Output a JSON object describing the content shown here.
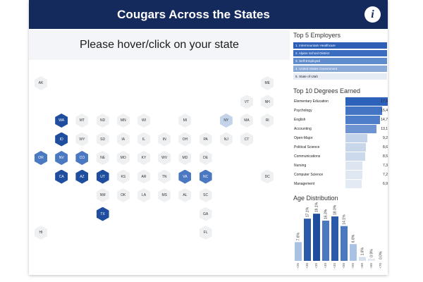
{
  "header": {
    "title": "Cougars Across the States",
    "info_icon": "info-icon",
    "info_glyph": "i"
  },
  "prompt": {
    "text": "Please hover/click on your state"
  },
  "colors": {
    "header_bg": "#142a5c",
    "dark": "#1f4e9e",
    "mid": "#4a79c1",
    "light": "#c3d3e9",
    "pale": "#e3ebf5",
    "faint": "#eef0f2"
  },
  "states": [
    {
      "abbr": "AK",
      "shade": "faint",
      "col": 0,
      "row": 0
    },
    {
      "abbr": "ME",
      "shade": "faint",
      "col": 11,
      "row": 0
    },
    {
      "abbr": "VT",
      "shade": "faint",
      "col": 10,
      "row": 1
    },
    {
      "abbr": "NH",
      "shade": "faint",
      "col": 11,
      "row": 1
    },
    {
      "abbr": "WA",
      "shade": "dark",
      "col": 1,
      "row": 2
    },
    {
      "abbr": "MT",
      "shade": "faint",
      "col": 2,
      "row": 2
    },
    {
      "abbr": "ND",
      "shade": "faint",
      "col": 3,
      "row": 2
    },
    {
      "abbr": "MN",
      "shade": "faint",
      "col": 4,
      "row": 2
    },
    {
      "abbr": "WI",
      "shade": "faint",
      "col": 5,
      "row": 2
    },
    {
      "abbr": "MI",
      "shade": "faint",
      "col": 7,
      "row": 2
    },
    {
      "abbr": "NY",
      "shade": "light",
      "col": 9,
      "row": 2
    },
    {
      "abbr": "MA",
      "shade": "faint",
      "col": 10,
      "row": 2
    },
    {
      "abbr": "RI",
      "shade": "faint",
      "col": 11,
      "row": 2
    },
    {
      "abbr": "ID",
      "shade": "dark",
      "col": 1,
      "row": 3
    },
    {
      "abbr": "WY",
      "shade": "faint",
      "col": 2,
      "row": 3
    },
    {
      "abbr": "SD",
      "shade": "faint",
      "col": 3,
      "row": 3
    },
    {
      "abbr": "IA",
      "shade": "faint",
      "col": 4,
      "row": 3
    },
    {
      "abbr": "IL",
      "shade": "faint",
      "col": 5,
      "row": 3
    },
    {
      "abbr": "IN",
      "shade": "faint",
      "col": 6,
      "row": 3
    },
    {
      "abbr": "OH",
      "shade": "faint",
      "col": 7,
      "row": 3
    },
    {
      "abbr": "PA",
      "shade": "faint",
      "col": 8,
      "row": 3
    },
    {
      "abbr": "NJ",
      "shade": "faint",
      "col": 9,
      "row": 3
    },
    {
      "abbr": "CT",
      "shade": "faint",
      "col": 10,
      "row": 3
    },
    {
      "abbr": "OR",
      "shade": "mid",
      "col": 0,
      "row": 4
    },
    {
      "abbr": "NV",
      "shade": "mid",
      "col": 1,
      "row": 4
    },
    {
      "abbr": "CO",
      "shade": "mid",
      "col": 2,
      "row": 4
    },
    {
      "abbr": "NE",
      "shade": "faint",
      "col": 3,
      "row": 4
    },
    {
      "abbr": "MO",
      "shade": "faint",
      "col": 4,
      "row": 4
    },
    {
      "abbr": "KY",
      "shade": "faint",
      "col": 5,
      "row": 4
    },
    {
      "abbr": "WV",
      "shade": "faint",
      "col": 6,
      "row": 4
    },
    {
      "abbr": "MD",
      "shade": "faint",
      "col": 7,
      "row": 4
    },
    {
      "abbr": "DE",
      "shade": "faint",
      "col": 8,
      "row": 4
    },
    {
      "abbr": "CA",
      "shade": "dark",
      "col": 1,
      "row": 5
    },
    {
      "abbr": "AZ",
      "shade": "dark",
      "col": 2,
      "row": 5
    },
    {
      "abbr": "UT",
      "shade": "dark",
      "col": 3,
      "row": 5
    },
    {
      "abbr": "KS",
      "shade": "faint",
      "col": 4,
      "row": 5
    },
    {
      "abbr": "AR",
      "shade": "faint",
      "col": 5,
      "row": 5
    },
    {
      "abbr": "TN",
      "shade": "faint",
      "col": 6,
      "row": 5
    },
    {
      "abbr": "VA",
      "shade": "mid",
      "col": 7,
      "row": 5
    },
    {
      "abbr": "NC",
      "shade": "mid",
      "col": 8,
      "row": 5
    },
    {
      "abbr": "DC",
      "shade": "faint",
      "col": 11,
      "row": 5
    },
    {
      "abbr": "NM",
      "shade": "faint",
      "col": 3,
      "row": 6
    },
    {
      "abbr": "OK",
      "shade": "faint",
      "col": 4,
      "row": 6
    },
    {
      "abbr": "LA",
      "shade": "faint",
      "col": 5,
      "row": 6
    },
    {
      "abbr": "MS",
      "shade": "faint",
      "col": 6,
      "row": 6
    },
    {
      "abbr": "AL",
      "shade": "faint",
      "col": 7,
      "row": 6
    },
    {
      "abbr": "SC",
      "shade": "faint",
      "col": 8,
      "row": 6
    },
    {
      "abbr": "TX",
      "shade": "dark",
      "col": 3,
      "row": 7
    },
    {
      "abbr": "GA",
      "shade": "faint",
      "col": 8,
      "row": 7
    },
    {
      "abbr": "HI",
      "shade": "faint",
      "col": 0,
      "row": 8
    },
    {
      "abbr": "FL",
      "shade": "faint",
      "col": 8,
      "row": 8
    }
  ],
  "employers": {
    "title": "Top 5 Employers",
    "items": [
      {
        "label": "1. Intermountain Healthcare",
        "shade": "#2c5fb5",
        "text": "#ffffff"
      },
      {
        "label": "2. Alpine School District",
        "shade": "#3a6cbf",
        "text": "#ffffff"
      },
      {
        "label": "3. Self-Employed",
        "shade": "#5f8ccc",
        "text": "#ffffff"
      },
      {
        "label": "4. United States Government",
        "shade": "#89a9d8",
        "text": "#ffffff"
      },
      {
        "label": "5. State of Utah",
        "shade": "#e6ecf4",
        "text": "#1c1c1c"
      }
    ]
  },
  "degrees": {
    "title": "Top 10 Degrees Earned",
    "items": [
      {
        "label": "Elementary Education",
        "value": "17,9",
        "amount": 17.9,
        "shade": "#2d62bb"
      },
      {
        "label": "Psychology",
        "value": "15,4",
        "amount": 15.4,
        "shade": "#4475c5"
      },
      {
        "label": "English",
        "value": "14,7",
        "amount": 14.7,
        "shade": "#4e7dc9"
      },
      {
        "label": "Accounting",
        "value": "13,1",
        "amount": 13.1,
        "shade": "#6e93d1"
      },
      {
        "label": "Open-Major",
        "value": "9,2",
        "amount": 9.2,
        "shade": "#c3d3e9"
      },
      {
        "label": "Political Science",
        "value": "8,6",
        "amount": 8.6,
        "shade": "#c8d6ea"
      },
      {
        "label": "Communications",
        "value": "8,5",
        "amount": 8.5,
        "shade": "#ccd9ec"
      },
      {
        "label": "Nursing",
        "value": "7,3",
        "amount": 7.3,
        "shade": "#dde5f1"
      },
      {
        "label": "Computer Science",
        "value": "7,2",
        "amount": 7.2,
        "shade": "#dfe7f2"
      },
      {
        "label": "Management",
        "value": "6,9",
        "amount": 6.9,
        "shade": "#e4eaf3"
      }
    ]
  },
  "age": {
    "title": "Age Distribution"
  },
  "chart_data": {
    "type": "bar",
    "title": "Age Distribution",
    "categories": [
      "<25",
      "<30",
      "<35",
      "<40",
      "<45",
      "<50",
      "<55",
      "<60",
      "<65",
      "<70"
    ],
    "values": [
      7.6,
      17.1,
      19.1,
      16.3,
      18.0,
      14.1,
      6.8,
      1.6,
      0.9,
      0.0
    ],
    "labels": [
      "7.6%",
      "17.1%",
      "19.1%",
      "16.3%",
      "18.0%",
      "14.1%",
      "6.8%",
      "1.6%",
      "0.9%",
      "0.0%"
    ],
    "ylim": [
      0,
      20
    ]
  }
}
